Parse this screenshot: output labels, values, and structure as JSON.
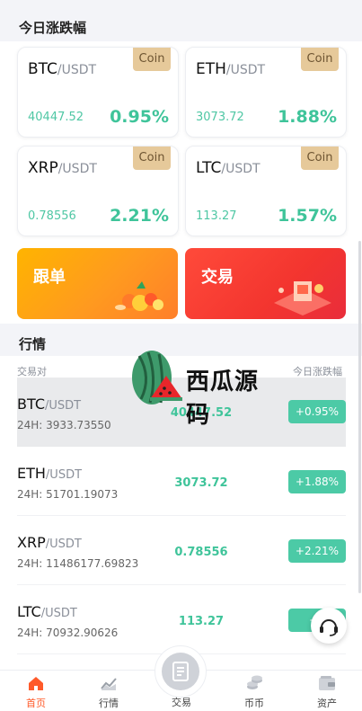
{
  "sections": {
    "today_change": "今日涨跌幅",
    "market": "行情"
  },
  "cards": [
    {
      "base": "BTC",
      "quote": "/USDT",
      "badge": "Coin",
      "price": "40447.52",
      "pct": "0.95%"
    },
    {
      "base": "ETH",
      "quote": "/USDT",
      "badge": "Coin",
      "price": "3073.72",
      "pct": "1.88%"
    },
    {
      "base": "XRP",
      "quote": "/USDT",
      "badge": "Coin",
      "price": "0.78556",
      "pct": "2.21%"
    },
    {
      "base": "LTC",
      "quote": "/USDT",
      "badge": "Coin",
      "price": "113.27",
      "pct": "1.57%"
    }
  ],
  "promos": {
    "follow": "跟单",
    "trade": "交易"
  },
  "market": {
    "col_pair": "交易对",
    "col_change": "今日涨跌幅",
    "rows": [
      {
        "base": "BTC",
        "quote": "/USDT",
        "vol": "24H: 3933.73550",
        "price": "40447.52",
        "chg": "+0.95%"
      },
      {
        "base": "ETH",
        "quote": "/USDT",
        "vol": "24H: 51701.19073",
        "price": "3073.72",
        "chg": "+1.88%"
      },
      {
        "base": "XRP",
        "quote": "/USDT",
        "vol": "24H: 11486177.69823",
        "price": "0.78556",
        "chg": "+2.21%"
      },
      {
        "base": "LTC",
        "quote": "/USDT",
        "vol": "24H: 70932.90626",
        "price": "113.27",
        "chg": "+1"
      }
    ]
  },
  "watermark": "西瓜源码",
  "tabs": [
    {
      "label": "首页",
      "icon": "home-icon"
    },
    {
      "label": "行情",
      "icon": "chart-icon"
    },
    {
      "label": "交易",
      "icon": "trade-icon"
    },
    {
      "label": "币币",
      "icon": "coins-icon"
    },
    {
      "label": "资产",
      "icon": "wallet-icon"
    }
  ],
  "colors": {
    "accent_green": "#3fc49a",
    "badge_gold": "#e6c99a",
    "active_tab": "#ff5a2a"
  }
}
